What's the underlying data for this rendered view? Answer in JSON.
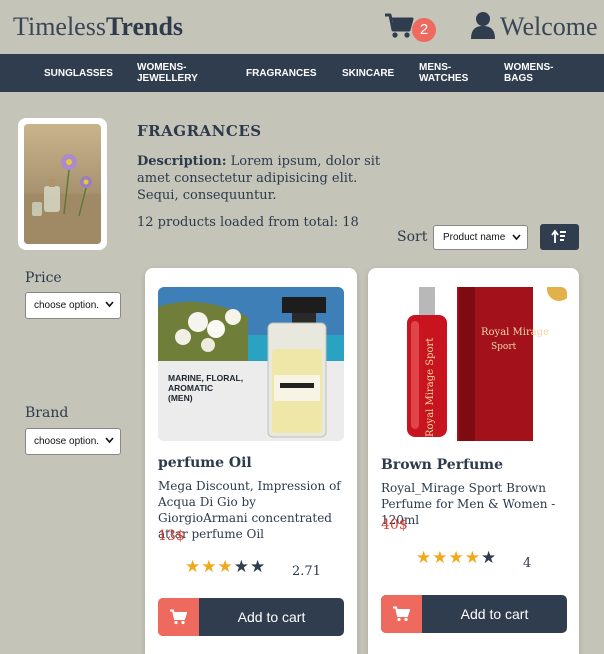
{
  "header": {
    "logo_light": "Timeless",
    "logo_bold": "Trends",
    "cart_count": "2",
    "welcome": "Welcome"
  },
  "nav": [
    {
      "label": "SUNGLASSES"
    },
    {
      "label": "WOMENS-JEWELLERY"
    },
    {
      "label": "FRAGRANCES"
    },
    {
      "label": "SKINCARE"
    },
    {
      "label": "MENS-WATCHES"
    },
    {
      "label": "WOMENS-BAGS"
    }
  ],
  "category": {
    "title": "FRAGRANCES",
    "description_label": "Description:",
    "description_text": "Lorem ipsum, dolor sit amet consectetur adipisicing elit. Sequi, consequuntur.",
    "loaded_text": "12 products loaded from total: 18"
  },
  "sort": {
    "label": "Sort",
    "selected": "Product name"
  },
  "filters": {
    "price_label": "Price",
    "price_selected": "choose option.",
    "brand_label": "Brand",
    "brand_selected": "choose option."
  },
  "products": [
    {
      "name": "perfume Oil",
      "description": "Mega Discount, Impression of Acqua Di Gio by GiorgioArmani concentrated attar perfume Oil",
      "price": "13$",
      "rating": "2.71",
      "stars_filled": 3,
      "image_caption": "MARINE, FLORAL, AROMATIC (MEN)",
      "add_label": "Add to cart"
    },
    {
      "name": "Brown Perfume",
      "description": "Royal_Mirage Sport Brown Perfume for Men & Women - 120ml",
      "price": "40$",
      "rating": "4",
      "stars_filled": 4,
      "image_caption": "Royal Mirage Sport",
      "add_label": "Add to cart"
    }
  ],
  "colors": {
    "background": "#c4c4b8",
    "navy": "#2f3d4f",
    "accent": "#ee6a5f",
    "price": "#e0392f",
    "star": "#f0a91d"
  }
}
